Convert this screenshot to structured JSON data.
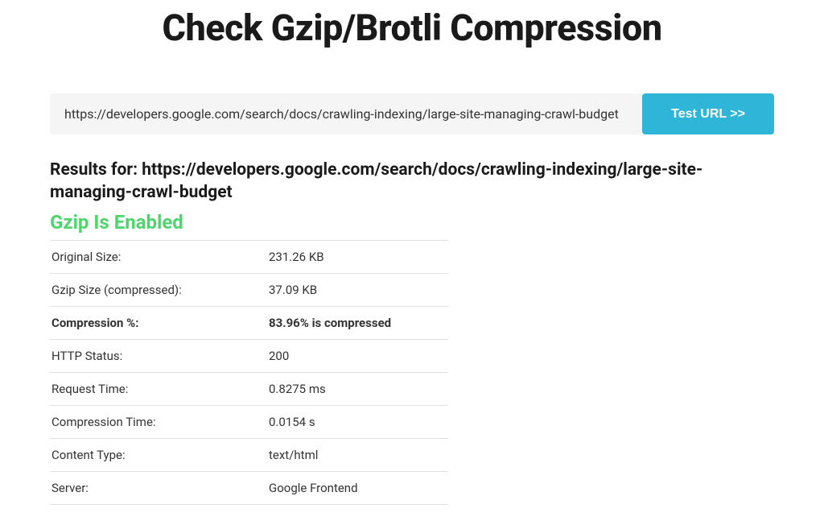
{
  "page": {
    "title": "Check Gzip/Brotli Compression"
  },
  "form": {
    "url_value": "https://developers.google.com/search/docs/crawling-indexing/large-site-managing-crawl-budget",
    "test_button_label": "Test URL >>"
  },
  "results": {
    "heading_prefix": "Results for: ",
    "url": "https://developers.google.com/search/docs/crawling-indexing/large-site-managing-crawl-budget",
    "gzip_status": "Gzip Is Enabled",
    "rows": [
      {
        "label": "Original Size:",
        "value": "231.26 KB",
        "bold": false
      },
      {
        "label": "Gzip Size (compressed):",
        "value": "37.09 KB",
        "bold": false
      },
      {
        "label": "Compression %:",
        "value": "83.96% is compressed",
        "bold": true
      },
      {
        "label": "HTTP Status:",
        "value": "200",
        "bold": false
      },
      {
        "label": "Request Time:",
        "value": "0.8275 ms",
        "bold": false
      },
      {
        "label": "Compression Time:",
        "value": "0.0154 s",
        "bold": false
      },
      {
        "label": "Content Type:",
        "value": "text/html",
        "bold": false
      },
      {
        "label": "Server:",
        "value": "Google Frontend",
        "bold": false
      }
    ]
  }
}
